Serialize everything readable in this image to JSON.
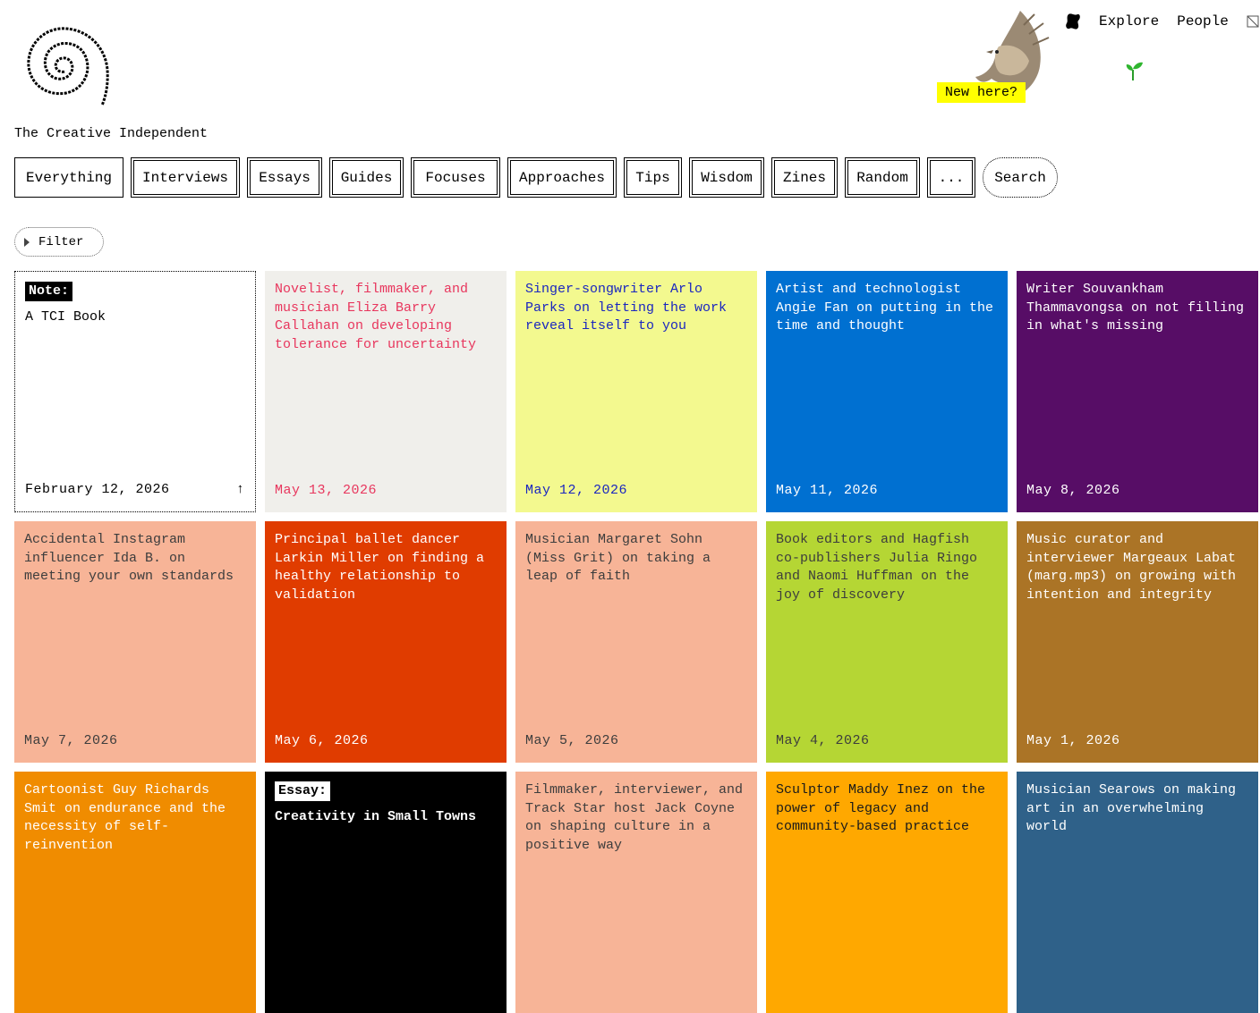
{
  "site": {
    "name": "The Creative Independent"
  },
  "top_nav": {
    "explore": "Explore",
    "people": "People"
  },
  "promo": {
    "new_here": "New here?"
  },
  "tabs": [
    "Everything",
    "Interviews",
    "Essays",
    "Guides",
    "Focuses",
    "Approaches",
    "Tips",
    "Wisdom",
    "Zines",
    "Random",
    "...",
    "Search"
  ],
  "filter": {
    "label": "Filter"
  },
  "cards": [
    {
      "tag": "Note:",
      "title": "A TCI Book",
      "date": "February 12, 2026",
      "bg": "#ffffff",
      "fg": "#000000",
      "tag_bg": "#000000",
      "tag_fg": "#ffffff",
      "arrow": "↑"
    },
    {
      "title": "Novelist, filmmaker, and musician Eliza Barry Callahan on developing tolerance for uncertainty",
      "date": "May 13, 2026",
      "bg": "#f0efeb",
      "fg": "#e8365d"
    },
    {
      "title": "Singer-songwriter Arlo Parks on letting the work reveal itself to you",
      "date": "May 12, 2026",
      "bg": "#f3f98f",
      "fg": "#1a26c0"
    },
    {
      "title": "Artist and technologist Angie Fan on putting in the time and thought",
      "date": "May 11, 2026",
      "bg": "#0070d1",
      "fg": "#ffffff"
    },
    {
      "title": "Writer Souvankham Thammavongsa on not filling in what's missing",
      "date": "May 8, 2026",
      "bg": "#570d66",
      "fg": "#ffffff"
    },
    {
      "title": "Accidental Instagram influencer Ida B. on meeting your own standards",
      "date": "May 7, 2026",
      "bg": "#f7b497",
      "fg": "#3d3d3d"
    },
    {
      "title": "Principal ballet dancer Larkin Miller on finding a healthy relationship to validation",
      "date": "May 6, 2026",
      "bg": "#e03c00",
      "fg": "#ffffff"
    },
    {
      "title": "Musician Margaret Sohn (Miss Grit) on taking a leap of faith",
      "date": "May 5, 2026",
      "bg": "#f7b497",
      "fg": "#3d3d3d"
    },
    {
      "title": "Book editors and Hagfish co-publishers Julia Ringo and Naomi Huffman on the joy of discovery",
      "date": "May 4, 2026",
      "bg": "#b5d634",
      "fg": "#3d3d3d"
    },
    {
      "title": "Music curator and interviewer Margeaux Labat (marg.mp3) on growing with intention and integrity",
      "date": "May 1, 2026",
      "bg": "#ab7426",
      "fg": "#ffffff"
    },
    {
      "title": "Cartoonist Guy Richards Smit on endurance and the necessity of self-reinvention",
      "date": "",
      "bg": "#f08c00",
      "fg": "#ffffff"
    },
    {
      "tag": "Essay:",
      "title": "Creativity in Small Towns",
      "date": "",
      "bg": "#000000",
      "fg": "#ffffff",
      "tag_bg": "#ffffff",
      "tag_fg": "#000000"
    },
    {
      "title": "Filmmaker, interviewer, and Track Star host Jack Coyne on shaping culture in a positive way",
      "date": "",
      "bg": "#f7b497",
      "fg": "#3d3d3d"
    },
    {
      "title": "Sculptor Maddy Inez on the power of legacy and community-based practice",
      "date": "",
      "bg": "#ffa800",
      "fg": "#1a1a1a"
    },
    {
      "title": "Musician Searows on making art in an overwhelming world",
      "date": "",
      "bg": "#2f6189",
      "fg": "#ffffff"
    }
  ]
}
